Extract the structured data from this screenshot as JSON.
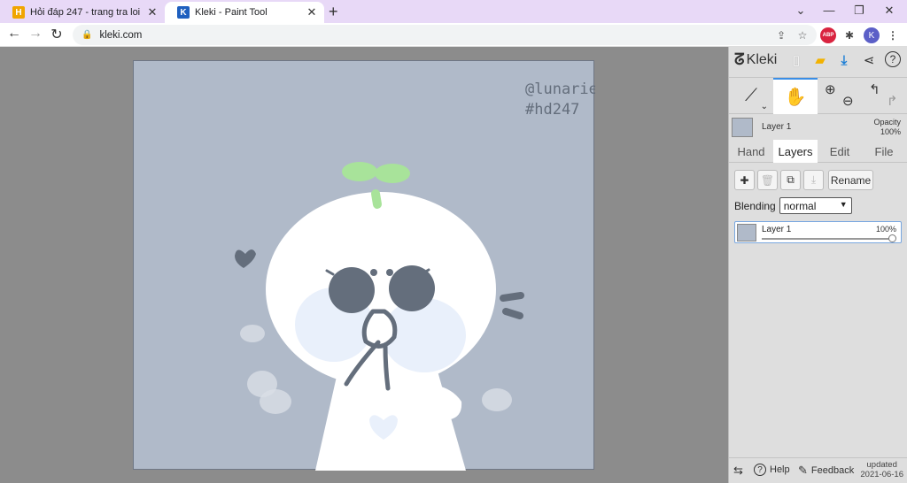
{
  "browser": {
    "tabs": [
      {
        "title": "Hỏi đáp 247 - trang tra loi",
        "favicon": "hd247-favicon",
        "active": false
      },
      {
        "title": "Kleki - Paint Tool",
        "favicon": "kleki-favicon",
        "active": true
      }
    ],
    "new_tab": "+",
    "url": "kleki.com",
    "profile_initial": "K",
    "adblock_label": "ABP"
  },
  "canvas": {
    "background": "#b0bac9",
    "signature_line1": "@lunarie",
    "signature_line2": "#hd247"
  },
  "panel": {
    "app_name": "Kleki",
    "current_layer": {
      "name": "Layer 1",
      "opacity_label": "Opacity",
      "opacity_value": "100%"
    },
    "tabs": [
      "Hand",
      "Layers",
      "Edit",
      "File"
    ],
    "active_tab": "Layers",
    "rename_label": "Rename",
    "blending_label": "Blending",
    "blending_value": "normal",
    "layers": [
      {
        "name": "Layer 1",
        "opacity": "100%",
        "opacity_fraction": 1.0
      }
    ],
    "footer": {
      "help": "Help",
      "feedback": "Feedback",
      "updated_line1": "updated",
      "updated_line2": "2021-06-16"
    }
  },
  "colors": {
    "tab_strip": "#e8d9f7",
    "canvas_bg": "#b0bac9",
    "sprout": "#a8e39a",
    "glasses": "#646e7c",
    "accent": "#3a8ee6"
  }
}
